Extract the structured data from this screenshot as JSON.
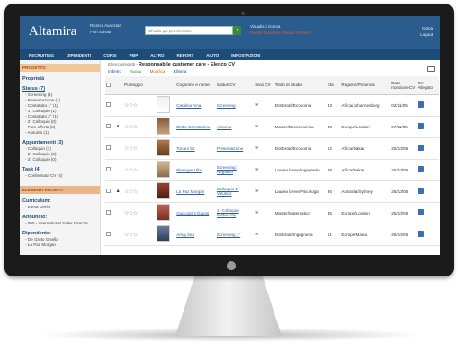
{
  "app": {
    "brand": "Altamira",
    "header_menu": [
      "Ricerca Avanzata",
      "Filtri Salvati"
    ],
    "search_placeholder": "Chiudo qui per ricercare",
    "user_line1": "Visualizzi ricerca",
    "user_line2": "Cliente Business (Nuovo Privato)",
    "links": [
      "Cerca",
      "Logout"
    ]
  },
  "nav": [
    "RECRUITING",
    "DIPENDENTI",
    "CORSI",
    "PMP",
    "ALTRO",
    "REPORT",
    "AIUTO",
    "IMPOSTAZIONI"
  ],
  "sidebar": {
    "section1": "PROGETTO",
    "proprieta": "Proprietà",
    "status_title": "Status (7)",
    "status_items": [
      "- Screening (1)",
      "- Presentazione (1)",
      "- Contattato 1° (1)",
      "- 1° Colloquio (1)",
      "- Contattato 2° (1)",
      "- 2° Colloquio (0)",
      "- Fare offerta (0)",
      "- Assunto (1)"
    ],
    "appuntamenti": "Appuntamenti (3)",
    "appuntamenti_items": [
      "- Colloquio (1)",
      "- 2° Colloquio (0)",
      "- 3° Colloquio (0)"
    ],
    "task": "Task (4)",
    "task_items": [
      "- Confermata CV (4)"
    ],
    "section2": "ELEMENTI RECENTI",
    "curriculum_title": "Curriculum:",
    "curriculum_items": [
      "- Elena Gerini"
    ],
    "annuncio_title": "Annuncio:",
    "annuncio_items": [
      "- 000 - International Sales Director"
    ],
    "dipendente_title": "Dipendente:",
    "dipendente_items": [
      "- De Gruto Gisella",
      "- La Paz Morgan"
    ]
  },
  "main": {
    "crumb_prefix": "Elenco progetti -",
    "crumb_title": "Responsabile customer care - Elenco CV",
    "actions": [
      "Indietro",
      "Nuovo",
      "Modifica",
      "Elimina"
    ],
    "columns": [
      "",
      "",
      "Punteggio",
      "",
      "Cognome e nome",
      "Status CV",
      "Invio CV",
      "Titolo di Studio",
      "Età",
      "Regione/Provincia",
      "Data ricezione CV",
      "CV Allegato"
    ],
    "rows": [
      {
        "stars": "☆☆☆",
        "name": "Catalina Aina",
        "status": "Screening",
        "study": "Dottorato/Economia",
        "age": "33",
        "region": "Africa/Johannesburg",
        "date": "02/11/05"
      },
      {
        "stars": "☆☆☆",
        "name": "Bisbo Constantino",
        "status": "Assunto",
        "study": "Master/Bocconomica",
        "age": "38",
        "region": "Europe/London",
        "date": "07/11/05"
      },
      {
        "stars": "☆☆☆",
        "name": "Tonani Sir",
        "status": "Presentazione",
        "study": "Dottorato/Economia",
        "age": "52",
        "region": "Africa/Dakar",
        "date": "25/10/05"
      },
      {
        "stars": "☆☆☆",
        "name": "Pieringer Ulla",
        "status": "Screening: Negativo",
        "study": "Laurea breve/Ingegneria",
        "age": "69",
        "region": "Africa/Dakar",
        "date": "25/10/05"
      },
      {
        "stars": "☆☆☆",
        "name": "La Paz Morgan",
        "status": "Colloquio 1° Valutato",
        "study": "Laurea breve/Psicologia",
        "age": "36",
        "region": "Australia/Sydney",
        "date": "25/10/05"
      },
      {
        "stars": "☆☆☆",
        "name": "Guicciarini Gianni",
        "status": "1° Colloquio Sufficiente",
        "study": "Master/Matematica",
        "age": "35",
        "region": "Europe/London",
        "date": "25/10/05"
      },
      {
        "stars": "☆☆☆",
        "name": "Amaj Sira",
        "status": "Screening 1°",
        "study": "Dottorato/Ingegneria",
        "age": "51",
        "region": "Europe/Maina",
        "date": "25/10/05"
      }
    ]
  },
  "colors": {
    "header": "#2a5d8e",
    "nav": "#1e4c78",
    "accent": "#f0c79b"
  }
}
